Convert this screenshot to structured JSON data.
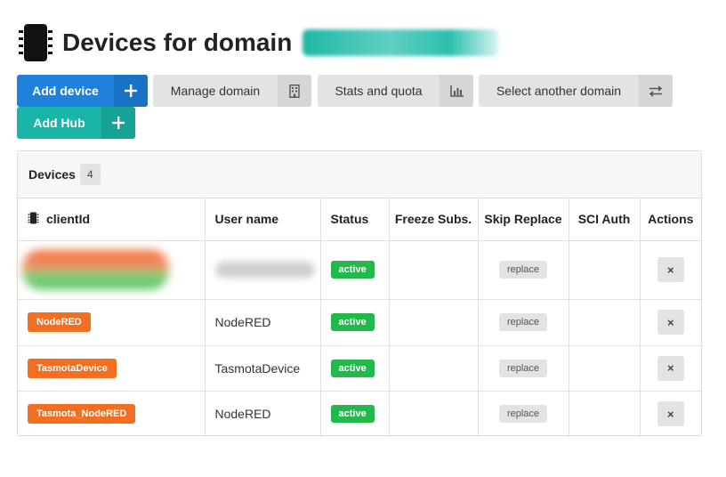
{
  "header": {
    "title": "Devices for domain",
    "icon": "chip-icon"
  },
  "toolbar": {
    "add_device": "Add device",
    "manage_domain": "Manage domain",
    "stats_quota": "Stats and quota",
    "select_domain": "Select another domain",
    "add_hub": "Add Hub"
  },
  "panel": {
    "title": "Devices",
    "count": "4"
  },
  "table": {
    "columns": [
      "clientId",
      "User name",
      "Status",
      "Freeze Subs.",
      "Skip Replace",
      "SCI Auth",
      "Actions"
    ],
    "rows": [
      {
        "client_id": "",
        "user_name": "",
        "status": "active",
        "skip_replace": "replace",
        "action": "×"
      },
      {
        "client_id": "NodeRED",
        "user_name": "NodeRED",
        "status": "active",
        "skip_replace": "replace",
        "action": "×"
      },
      {
        "client_id": "TasmotaDevice",
        "user_name": "TasmotaDevice",
        "status": "active",
        "skip_replace": "replace",
        "action": "×"
      },
      {
        "client_id": "Tasmota_NodeRED",
        "user_name": "NodeRED",
        "status": "active",
        "skip_replace": "replace",
        "action": "×"
      }
    ]
  },
  "colors": {
    "primary": "#1f81d9",
    "teal": "#1ab5a6",
    "tag_orange": "#f26f21",
    "status_green": "#22b84c"
  }
}
